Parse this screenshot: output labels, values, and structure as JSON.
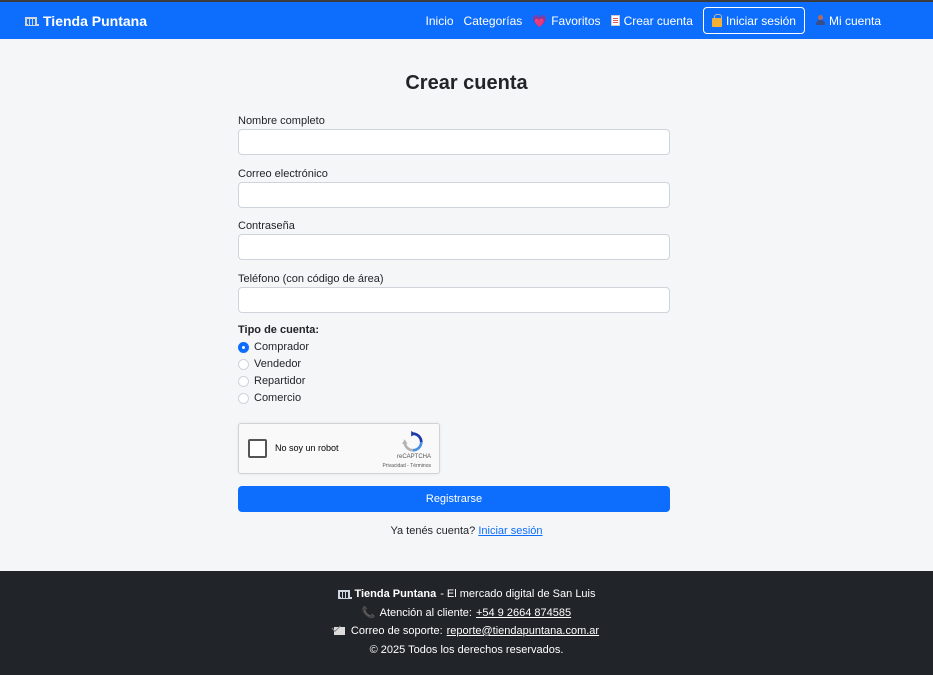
{
  "navbar": {
    "brand": "Tienda Puntana",
    "links": {
      "inicio": "Inicio",
      "categorias": "Categorías",
      "favoritos": "Favoritos",
      "crear_cuenta": "Crear cuenta",
      "iniciar_sesion": "Iniciar sesión",
      "mi_cuenta": "Mi cuenta"
    },
    "color": "#0d6efd"
  },
  "form": {
    "title": "Crear cuenta",
    "fields": {
      "nombre": {
        "label": "Nombre completo",
        "value": ""
      },
      "correo": {
        "label": "Correo electrónico",
        "value": ""
      },
      "contrasena": {
        "label": "Contraseña",
        "value": ""
      },
      "telefono": {
        "label": "Teléfono (con código de área)",
        "value": ""
      }
    },
    "account_type": {
      "label": "Tipo de cuenta:",
      "options": [
        "Comprador",
        "Vendedor",
        "Repartidor",
        "Comercio"
      ],
      "selected": "Comprador"
    },
    "recaptcha": {
      "label": "No soy un robot",
      "brand": "reCAPTCHA",
      "links": "Privacidad - Términos"
    },
    "submit_label": "Registrarse",
    "login_prompt": "Ya tenés cuenta?",
    "login_link": "Iniciar sesión"
  },
  "footer": {
    "brand": "Tienda Puntana",
    "tagline": " - El mercado digital de San Luis",
    "support_label": "Atención al cliente:",
    "support_phone": "+54 9 2664 874585",
    "email_label": "Correo de soporte:",
    "email": "reporte@tiendapuntana.com.ar",
    "copyright": "© 2025 Todos los derechos reservados."
  }
}
